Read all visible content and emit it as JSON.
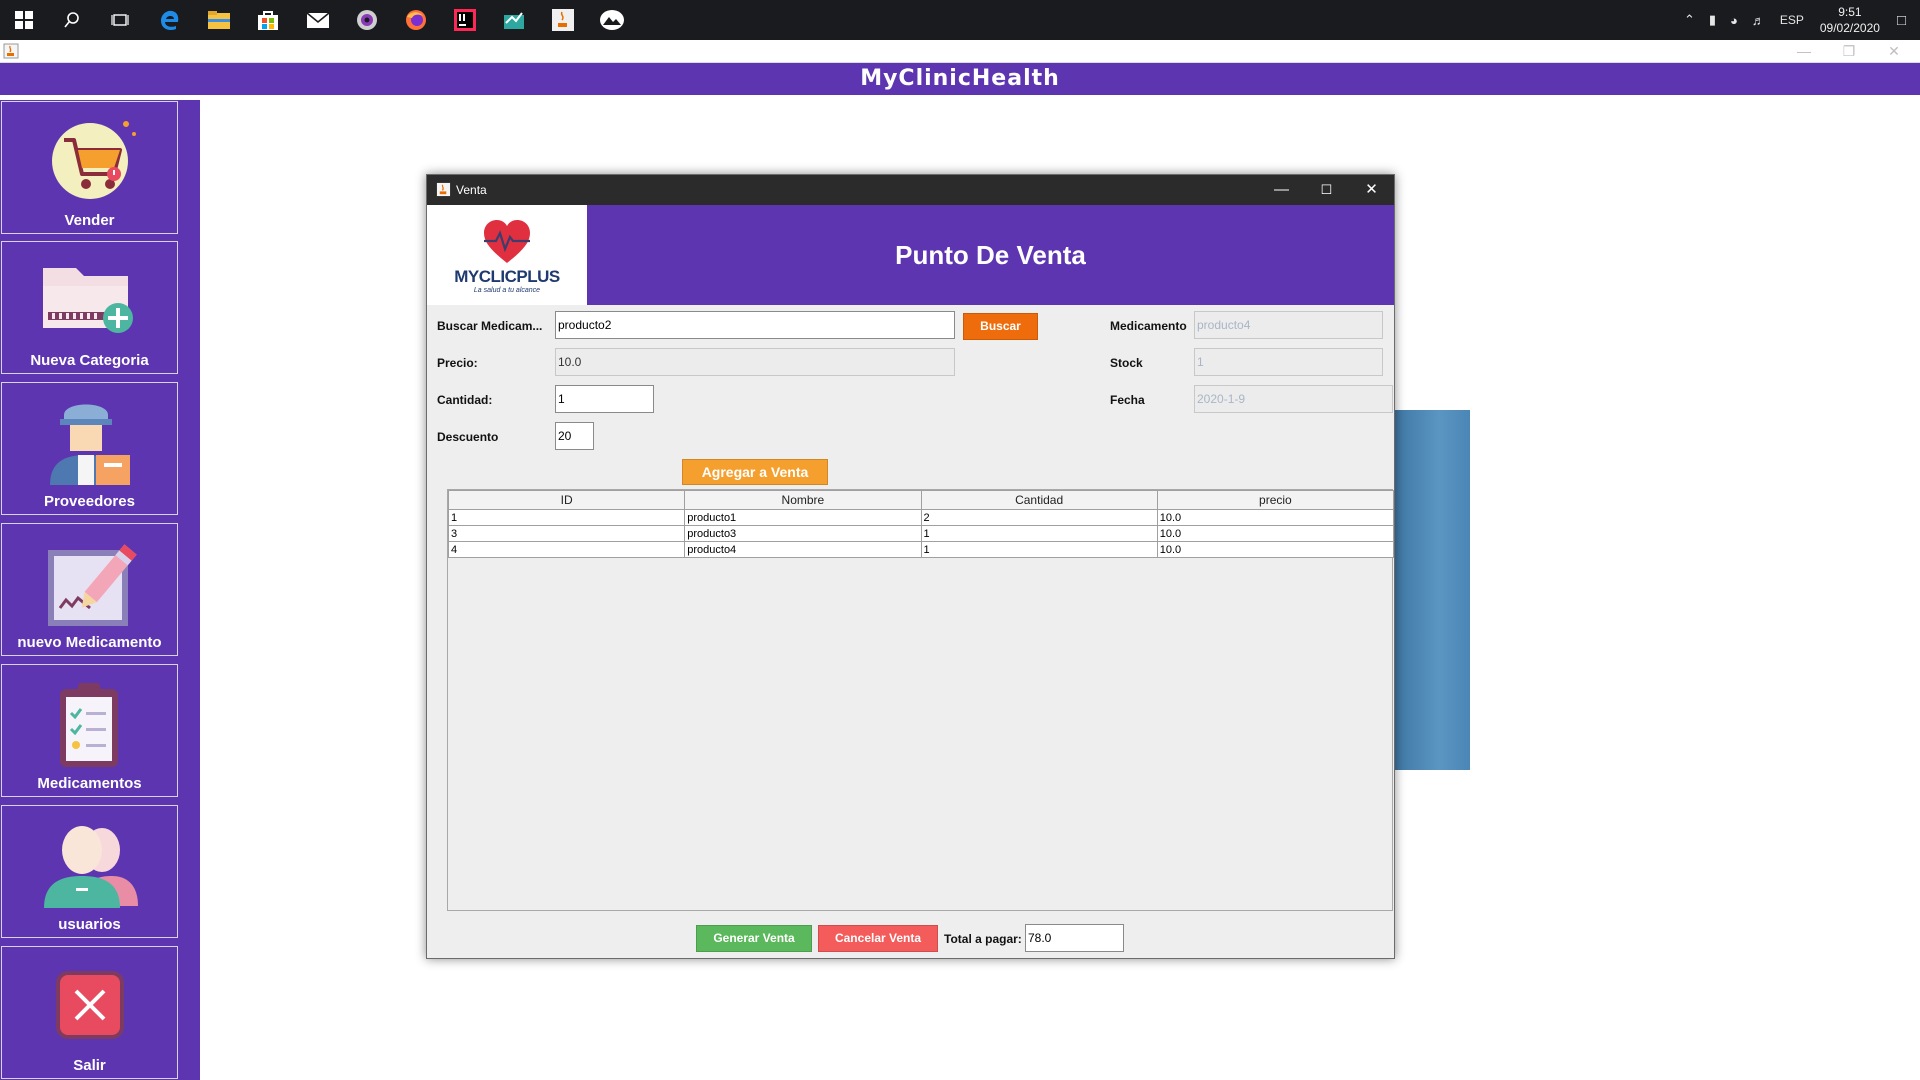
{
  "taskbar": {
    "icons": [
      "windows-icon",
      "search-icon",
      "task-view-icon",
      "edge-icon",
      "file-explorer-icon",
      "store-icon",
      "mail-icon",
      "media-icon",
      "firefox-icon",
      "intellij-icon",
      "app-icon",
      "java-icon",
      "photos-icon"
    ],
    "language": "ESP",
    "time": "9:51",
    "date": "09/02/2020"
  },
  "app": {
    "title": "MyClinicHealth",
    "sidebar": [
      {
        "label": "Vender",
        "icon": "shopping-cart-icon"
      },
      {
        "label": "Nueva Categoria",
        "icon": "folder-add-icon"
      },
      {
        "label": "Proveedores",
        "icon": "delivery-person-icon"
      },
      {
        "label": "nuevo Medicamento",
        "icon": "edit-document-icon"
      },
      {
        "label": "Medicamentos",
        "icon": "clipboard-checklist-icon"
      },
      {
        "label": "usuarios",
        "icon": "users-icon"
      },
      {
        "label": "Salir",
        "icon": "close-box-icon"
      }
    ]
  },
  "dialog": {
    "title": "Venta",
    "logo": {
      "name": "MYCLICPLUS",
      "tagline": "La salud a tu alcance"
    },
    "heading": "Punto De Venta",
    "form": {
      "buscar_label": "Buscar Medicam...",
      "buscar_value": "producto2",
      "buscar_button": "Buscar",
      "precio_label": "Precio:",
      "precio_value": "10.0",
      "cantidad_label": "Cantidad:",
      "cantidad_value": "1",
      "descuento_label": "Descuento",
      "descuento_value": "20",
      "medicamento_label": "Medicamento",
      "medicamento_value": "producto4",
      "stock_label": "Stock",
      "stock_value": "1",
      "fecha_label": "Fecha",
      "fecha_value": "2020-1-9",
      "agregar_button": "Agregar a Venta"
    },
    "table": {
      "columns": [
        "ID",
        "Nombre",
        "Cantidad",
        "precio"
      ],
      "rows": [
        [
          "1",
          "producto1",
          "2",
          "10.0"
        ],
        [
          "3",
          "producto3",
          "1",
          "10.0"
        ],
        [
          "4",
          "producto4",
          "1",
          "10.0"
        ]
      ]
    },
    "footer": {
      "generar_button": "Generar Venta",
      "cancelar_button": "Cancelar Venta",
      "total_label": "Total a pagar:",
      "total_value": "78.0"
    }
  }
}
